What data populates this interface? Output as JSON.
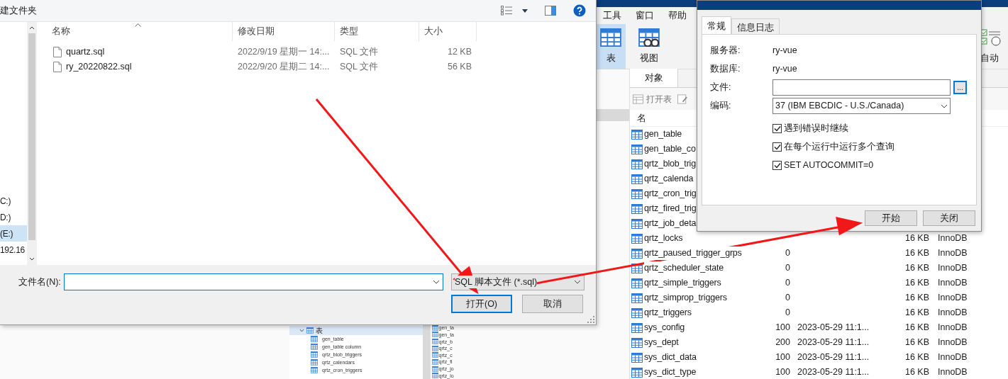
{
  "navicat": {
    "menu": [
      "工具",
      "窗口",
      "帮助"
    ],
    "toolbar": [
      {
        "label": "表",
        "kind": "table",
        "selected": true
      },
      {
        "label": "视图",
        "kind": "view",
        "selected": false
      },
      {
        "label": "自动",
        "kind": "automation",
        "selected": false
      }
    ],
    "tabs": [
      {
        "label": "对象",
        "selected": true
      }
    ],
    "object_toolbar": [
      "打开表"
    ],
    "table": {
      "columns": [
        "名"
      ],
      "rows": [
        {
          "name": "gen_table"
        },
        {
          "name": "gen_table_co"
        },
        {
          "name": "qrtz_blob_trig"
        },
        {
          "name": "qrtz_calenda"
        },
        {
          "name": "qrtz_cron_trig"
        },
        {
          "name": "qrtz_fired_trig"
        },
        {
          "name": "qrtz_job_deta"
        },
        {
          "name": "qrtz_locks",
          "size": "16 KB",
          "engine": "InnoDB"
        },
        {
          "name": "qrtz_paused_trigger_grps",
          "rows": "0",
          "size": "16 KB",
          "engine": "InnoDB"
        },
        {
          "name": "qrtz_scheduler_state",
          "rows": "0",
          "size": "16 KB",
          "engine": "InnoDB"
        },
        {
          "name": "qrtz_simple_triggers",
          "rows": "0",
          "size": "16 KB",
          "engine": "InnoDB"
        },
        {
          "name": "qrtz_simprop_triggers",
          "rows": "0",
          "size": "16 KB",
          "engine": "InnoDB"
        },
        {
          "name": "qrtz_triggers",
          "rows": "0",
          "size": "16 KB",
          "engine": "InnoDB"
        },
        {
          "name": "sys_config",
          "rows": "100",
          "modified": "2023-05-29 11:1...",
          "size": "16 KB",
          "engine": "InnoDB"
        },
        {
          "name": "sys_dept",
          "rows": "200",
          "modified": "2023-05-29 11:1...",
          "size": "16 KB",
          "engine": "InnoDB"
        },
        {
          "name": "sys_dict_data",
          "rows": "100",
          "modified": "2023-05-29 11:1...",
          "size": "16 KB",
          "engine": "InnoDB"
        },
        {
          "name": "sys_dict_type",
          "rows": "100",
          "modified": "2023-05-29 11:1...",
          "size": "16 KB",
          "engine": "InnoDB"
        }
      ]
    },
    "thumbnail": {
      "tree": {
        "label": "表",
        "expanded": true,
        "selected": true,
        "children": [
          {
            "label": "gen_table",
            "selected": false
          },
          {
            "label": "gen_table column",
            "selected": false
          },
          {
            "label": "qrtz_blob_triggers",
            "selected": false
          },
          {
            "label": "qrtz_calendars",
            "selected": false
          },
          {
            "label": "qrtz_cron_triggers",
            "selected": false
          }
        ]
      },
      "list": [
        "gen_ta",
        "gen_ta",
        "qrtz_b",
        "qrtz_c",
        "qrtz_c",
        "qrtz_fi",
        "qrtz_jo",
        "qrtz_lo"
      ]
    }
  },
  "file_dialog": {
    "toolbar_button": "建文件夹",
    "nav_items": [
      {
        "label": "C:)",
        "selected": false
      },
      {
        "label": "D:)",
        "selected": false
      },
      {
        "label": "(E:)",
        "selected": true
      },
      {
        "label": "192.16",
        "selected": false
      }
    ],
    "columns": [
      "名称",
      "修改日期",
      "类型",
      "大小"
    ],
    "files": [
      {
        "name": "quartz.sql",
        "modified": "2022/9/19 星期一 14:...",
        "type": "SQL 文件",
        "size": "12 KB"
      },
      {
        "name": "ry_20220822.sql",
        "modified": "2022/9/20 星期二 14:...",
        "type": "SQL 文件",
        "size": "56 KB"
      }
    ],
    "filename_label": "文件名(N):",
    "filter": "SQL 脚本文件 (*.sql)",
    "buttons": [
      {
        "label": "打开(O)",
        "default": true
      },
      {
        "label": "取消",
        "default": false
      }
    ]
  },
  "sql_dialog": {
    "tabs": [
      {
        "label": "常规",
        "selected": true
      },
      {
        "label": "信息日志",
        "selected": false
      }
    ],
    "fields": [
      {
        "kind": "text",
        "label": "服务器:",
        "value": "ry-vue"
      },
      {
        "kind": "text",
        "label": "数据库:",
        "value": "ry-vue"
      },
      {
        "kind": "file",
        "label": "文件:",
        "browse": "..."
      },
      {
        "kind": "select",
        "label": "编码:",
        "value": "37 (IBM EBCDIC - U.S./Canada)"
      }
    ],
    "options": [
      {
        "label": "遇到错误时继续",
        "checked": true
      },
      {
        "label": "在每个运行中运行多个查询",
        "checked": true
      },
      {
        "label": "SET AUTOCOMMIT=0",
        "checked": true
      }
    ],
    "buttons": [
      "开始",
      "关闭"
    ]
  }
}
